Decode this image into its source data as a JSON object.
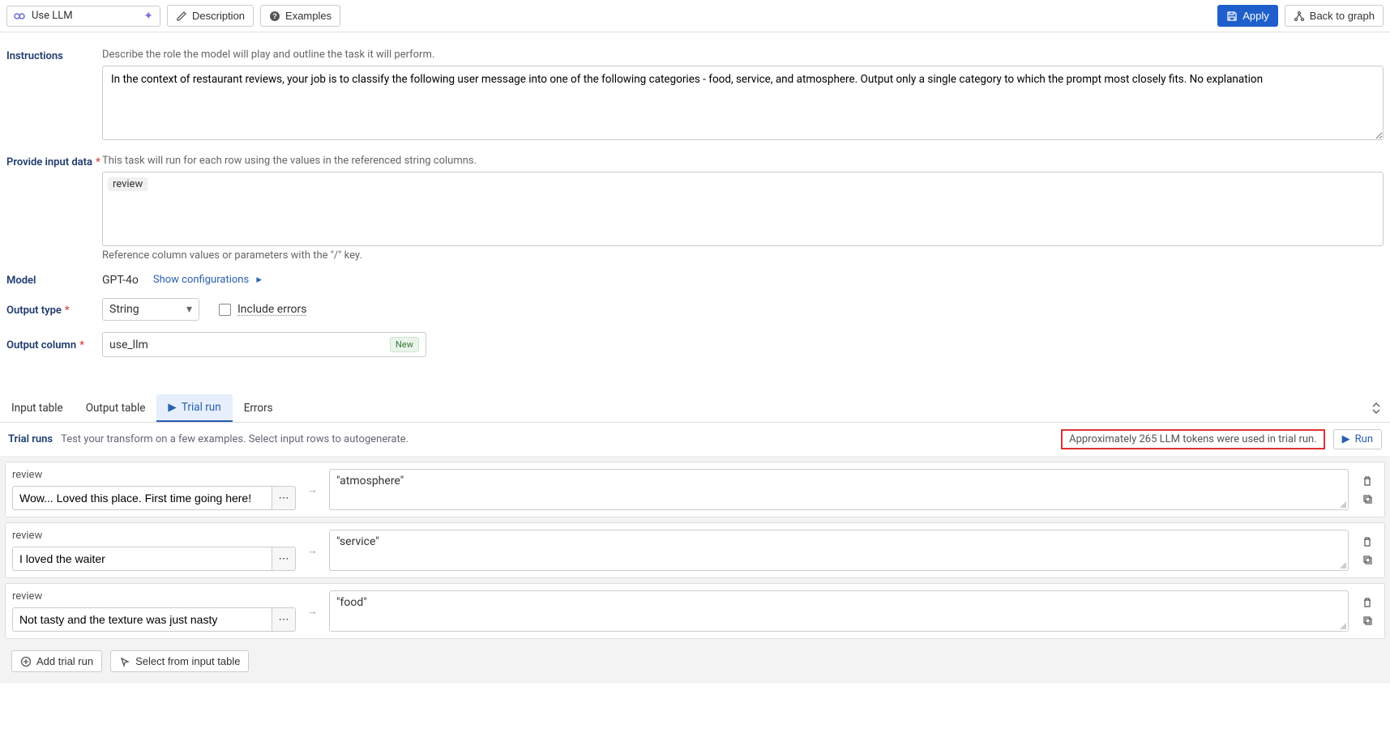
{
  "topbar": {
    "node_label": "Use LLM",
    "description_btn": "Description",
    "examples_btn": "Examples",
    "apply_btn": "Apply",
    "back_btn": "Back to graph"
  },
  "instructions": {
    "label": "Instructions",
    "hint": "Describe the role the model will play and outline the task it will perform.",
    "value": "In the context of restaurant reviews, your job is to classify the following user message into one of the following categories - food, service, and atmosphere. Output only a single category to which the prompt most closely fits. No explanation"
  },
  "input_data": {
    "label": "Provide input data",
    "hint": "This task will run for each row using the values in the referenced string columns.",
    "token": "review",
    "subhint": "Reference column values or parameters with the \"/\" key."
  },
  "model": {
    "label": "Model",
    "value": "GPT-4o",
    "config_link": "Show configurations"
  },
  "output_type": {
    "label": "Output type",
    "value": "String",
    "include_errors": "Include errors"
  },
  "output_column": {
    "label": "Output column",
    "value": "use_llm",
    "badge": "New"
  },
  "tabs": {
    "input": "Input table",
    "output": "Output table",
    "trial": "Trial run",
    "errors": "Errors"
  },
  "trial": {
    "title": "Trial runs",
    "subtitle": "Test your transform on a few examples. Select input rows to autogenerate.",
    "token_msg": "Approximately 265 LLM tokens were used in trial run.",
    "run_btn": "Run",
    "rows": [
      {
        "label": "review",
        "input": "Wow... Loved this place. First time going here!",
        "output": "\"atmosphere\""
      },
      {
        "label": "review",
        "input": "I loved the waiter",
        "output": "\"service\""
      },
      {
        "label": "review",
        "input": "Not tasty and the texture was just nasty",
        "output": "\"food\""
      }
    ],
    "add_row": "Add trial run",
    "select_input": "Select from input table"
  }
}
